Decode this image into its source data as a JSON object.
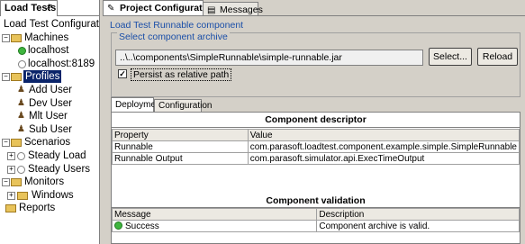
{
  "left_panel": {
    "tab_label": "Load Tests",
    "tree": {
      "root": "Load Test Configuratio",
      "machines": {
        "label": "Machines",
        "items": [
          "localhost",
          "localhost:8189"
        ]
      },
      "profiles": {
        "label": "Profiles",
        "items": [
          "Add User",
          "Dev User",
          "Mlt User",
          "Sub User"
        ]
      },
      "scenarios": {
        "label": "Scenarios",
        "items": [
          "Steady Load",
          "Steady Users"
        ]
      },
      "monitors": {
        "label": "Monitors",
        "items": [
          "Windows"
        ]
      },
      "reports": {
        "label": "Reports"
      }
    }
  },
  "editor": {
    "tabs": [
      {
        "label": "Project Configuration",
        "active": true
      },
      {
        "label": "Messages",
        "active": false
      }
    ],
    "title": "Load Test Runnable component",
    "archive": {
      "legend": "Select component archive",
      "path": "..\\..\\components\\SimpleRunnable\\simple-runnable.jar",
      "select_button": "Select...",
      "reload_button": "Reload",
      "persist_checked": true,
      "persist_label": "Persist as relative path"
    },
    "inner_tabs": [
      {
        "label": "Deployment",
        "active": true
      },
      {
        "label": "Configuration",
        "active": false
      }
    ],
    "descriptor": {
      "title": "Component descriptor",
      "columns": [
        "Property",
        "Value"
      ],
      "rows": [
        [
          "Runnable",
          "com.parasoft.loadtest.component.example.simple.SimpleRunnable"
        ],
        [
          "Runnable Output",
          "com.parasoft.simulator.api.ExecTimeOutput"
        ]
      ]
    },
    "validation": {
      "title": "Component validation",
      "columns": [
        "Message",
        "Description"
      ],
      "rows": [
        [
          "Success",
          "Component archive is valid."
        ]
      ]
    }
  },
  "colors": {
    "accent_blue": "#1b4fa8",
    "selection": "#0a246a",
    "success_green": "#3fb53f",
    "panel_bg": "#d4d0c8"
  }
}
